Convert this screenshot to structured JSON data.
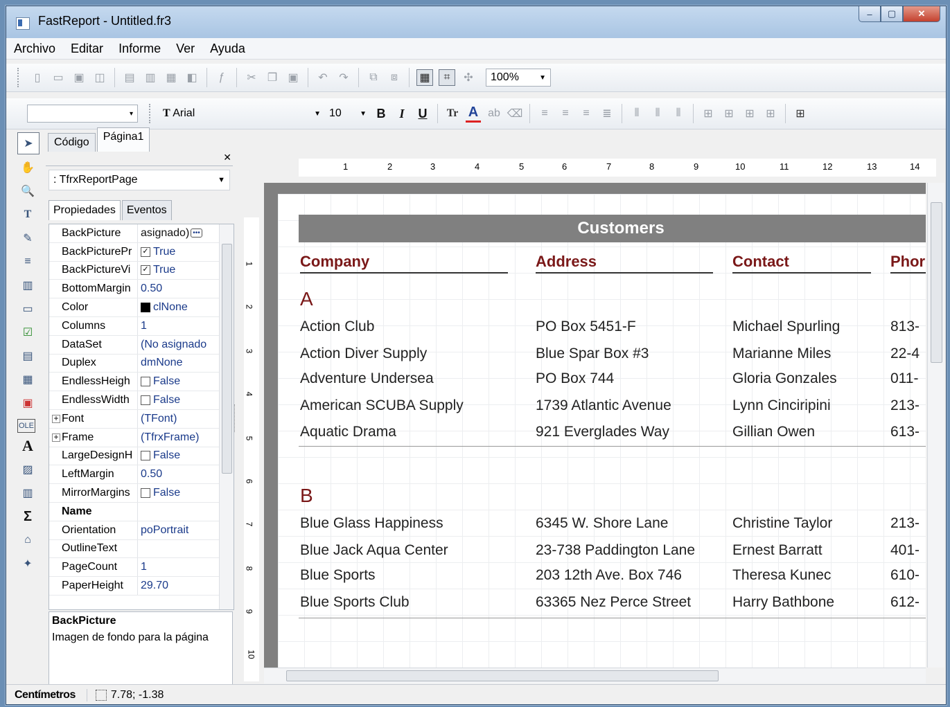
{
  "window": {
    "title": "FastReport - Untitled.fr3"
  },
  "menu": [
    "Archivo",
    "Editar",
    "Informe",
    "Ver",
    "Ayuda"
  ],
  "toolbar": {
    "zoom": "100%"
  },
  "format": {
    "font_name": "Arial",
    "font_size": "10",
    "bold": "B",
    "italic": "I",
    "underline": "U",
    "font_icon": "Tr"
  },
  "tabs": {
    "code": "Código",
    "page": "Página1"
  },
  "inspector": {
    "object": ": TfrxReportPage",
    "tab_props": "Propiedades",
    "tab_events": "Eventos",
    "rows": [
      {
        "name": "BackPicture",
        "value": "asignado)"
      },
      {
        "name": "BackPicturePr",
        "value": "True"
      },
      {
        "name": "BackPictureVi",
        "value": "True"
      },
      {
        "name": "BottomMargin",
        "value": "0.50"
      },
      {
        "name": "Color",
        "value": "clNone"
      },
      {
        "name": "Columns",
        "value": "1"
      },
      {
        "name": "DataSet",
        "value": "(No asignado"
      },
      {
        "name": "Duplex",
        "value": "dmNone"
      },
      {
        "name": "EndlessHeigh",
        "value": "False"
      },
      {
        "name": "EndlessWidth",
        "value": "False"
      },
      {
        "name": "Font",
        "value": "(TFont)"
      },
      {
        "name": "Frame",
        "value": "(TfrxFrame)"
      },
      {
        "name": "LargeDesignH",
        "value": "False"
      },
      {
        "name": "LeftMargin",
        "value": "0.50"
      },
      {
        "name": "MirrorMargins",
        "value": "False"
      },
      {
        "name": "Name",
        "value": ""
      },
      {
        "name": "Orientation",
        "value": "poPortrait"
      },
      {
        "name": "OutlineText",
        "value": ""
      },
      {
        "name": "PageCount",
        "value": "1"
      },
      {
        "name": "PaperHeight",
        "value": "29.70"
      }
    ],
    "hint_title": "BackPicture",
    "hint_text": "Imagen de fondo para la página"
  },
  "report": {
    "title": "Customers",
    "headers": [
      "Company",
      "Address",
      "Contact",
      "Phor"
    ],
    "group_a": "A",
    "group_b": "B",
    "rows_a": [
      [
        "Action Club",
        "PO Box 5451-F",
        "Michael Spurling",
        "813-"
      ],
      [
        "Action Diver Supply",
        "Blue Spar Box #3",
        "Marianne Miles",
        "22-4"
      ],
      [
        "Adventure Undersea",
        "PO Box 744",
        "Gloria Gonzales",
        "011-"
      ],
      [
        "American SCUBA Supply",
        "1739 Atlantic Avenue",
        "Lynn Cinciripini",
        "213-"
      ],
      [
        "Aquatic Drama",
        "921 Everglades Way",
        "Gillian Owen",
        "613-"
      ]
    ],
    "rows_b": [
      [
        "Blue Glass Happiness",
        "6345 W. Shore Lane",
        "Christine Taylor",
        "213-"
      ],
      [
        "Blue Jack Aqua Center",
        "23-738 Paddington Lane",
        "Ernest Barratt",
        "401-"
      ],
      [
        "Blue Sports",
        "203 12th Ave. Box 746",
        "Theresa Kunec",
        "610-"
      ],
      [
        "Blue Sports Club",
        "63365 Nez Perce Street",
        "Harry Bathbone",
        "612-"
      ]
    ]
  },
  "status": {
    "unit": "Centímetros",
    "position": "7.78; -1.38"
  }
}
